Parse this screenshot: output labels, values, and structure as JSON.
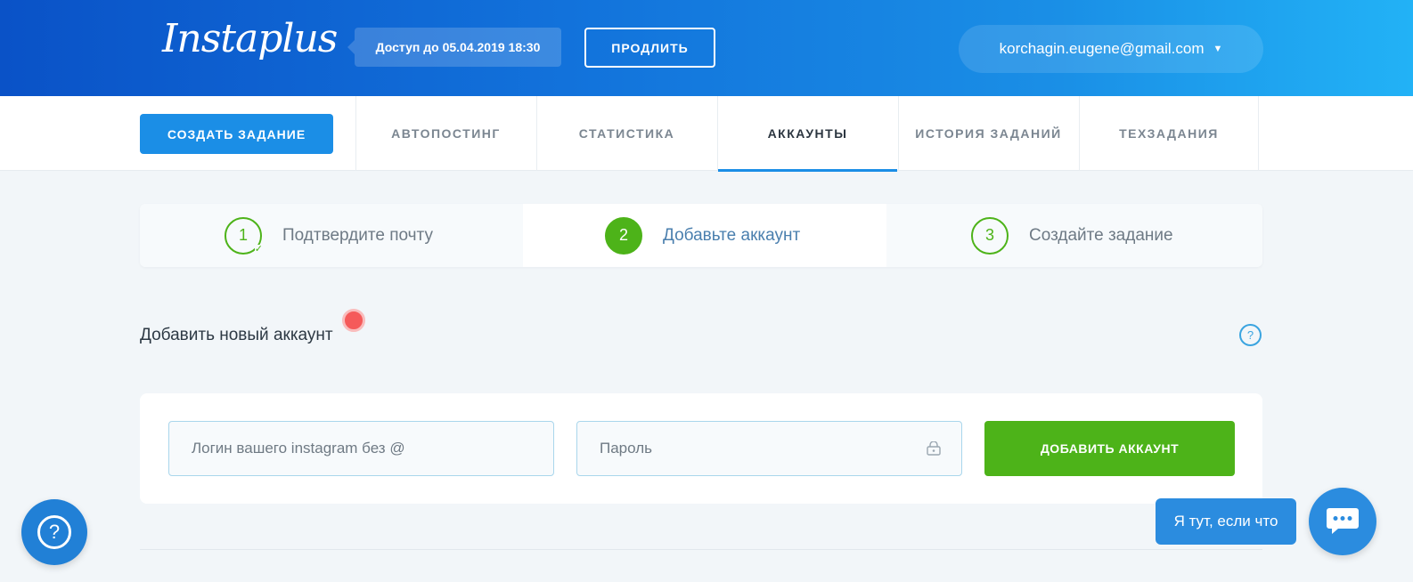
{
  "header": {
    "logo": "Instaplus",
    "access_text": "Доступ до 05.04.2019 18:30",
    "renew_label": "ПРОДЛИТЬ",
    "user_email": "korchagin.eugene@gmail.com",
    "user_menu_icon": "chevron-down-icon"
  },
  "nav": {
    "create_label": "СОЗДАТЬ ЗАДАНИЕ",
    "tabs": [
      {
        "label": "АВТОПОСТИНГ",
        "active": false
      },
      {
        "label": "СТАТИСТИКА",
        "active": false
      },
      {
        "label": "АККАУНТЫ",
        "active": true
      },
      {
        "label": "ИСТОРИЯ ЗАДАНИЙ",
        "active": false
      },
      {
        "label": "ТЕХЗАДАНИЯ",
        "active": false
      }
    ]
  },
  "steps": [
    {
      "number": "1",
      "label": "Подтвердите почту",
      "state": "done"
    },
    {
      "number": "2",
      "label": "Добавьте аккаунт",
      "state": "active"
    },
    {
      "number": "3",
      "label": "Создайте задание",
      "state": "pending"
    }
  ],
  "section": {
    "title": "Добавить новый аккаунт",
    "help_icon": "?"
  },
  "form": {
    "login_placeholder": "Логин вашего instagram без @",
    "password_placeholder": "Пароль",
    "password_icon": "lock-icon",
    "submit_label": "ДОБАВИТЬ АККАУНТ"
  },
  "floating": {
    "help_icon": "?",
    "chat_text": "Я тут, если что",
    "chat_icon": "chat-icon"
  },
  "colors": {
    "accent_blue": "#1b8ee6",
    "success_green": "#4db319",
    "alert_red": "#f55a5a"
  }
}
